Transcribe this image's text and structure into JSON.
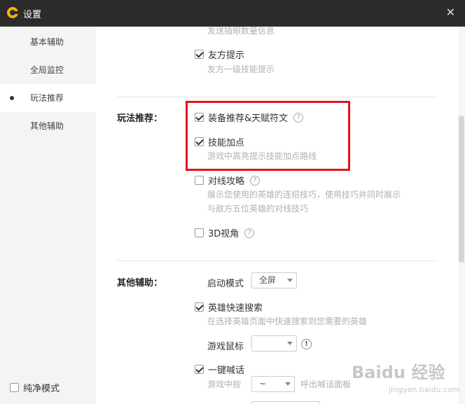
{
  "window": {
    "title": "设置",
    "close": "✕"
  },
  "sidebar": {
    "items": [
      {
        "label": "基本辅助"
      },
      {
        "label": "全局监控"
      },
      {
        "label": "玩法推荐"
      },
      {
        "label": "其他辅助"
      }
    ],
    "active_index": 2,
    "pure_mode": {
      "label": "纯净模式",
      "checked": false
    }
  },
  "content": {
    "top_partial_desc": "发送插眼数量信息",
    "friend_hint": {
      "label": "友方提示",
      "desc": "友方一级技能提示",
      "checked": true
    },
    "play_section": {
      "label": "玩法推荐：",
      "equip": {
        "label": "装备推荐&天赋符文",
        "checked": true
      },
      "skill": {
        "label": "技能加点",
        "desc": "游戏中高亮提示技能加点路线",
        "checked": true
      },
      "lane": {
        "label": "对线攻略",
        "desc1": "展示您使用的英雄的连招技巧，使用技巧并同时展示",
        "desc2": "与敌方五位英雄的对线技巧",
        "checked": false
      },
      "view3d": {
        "label": "3D视角",
        "checked": false
      }
    },
    "other_section": {
      "label": "其他辅助：",
      "start_mode": {
        "label": "启动模式",
        "value": "全屏"
      },
      "quick_search": {
        "label": "英雄快速搜索",
        "desc": "在选择英雄页面中快速搜索到您需要的英雄",
        "checked": true
      },
      "mouse": {
        "label": "游戏鼠标",
        "value": "",
        "warn": "!"
      },
      "shout": {
        "label": "一键喊话",
        "checked": true,
        "prefix": "游戏中按",
        "key": "~",
        "suffix": "呼出喊话面板"
      }
    },
    "help_glyph": "?"
  },
  "watermark": {
    "main": "Baidu 经验",
    "sub": "jingyan.baidu.com"
  },
  "colors": {
    "titlebar": "#2b2b2b",
    "logo": "#f5b400",
    "highlight": "#e0141e",
    "sidebar": "#f4f4f4"
  },
  "icons": [
    "logo-icon",
    "close-icon",
    "checkbox-icon",
    "help-icon",
    "dropdown-caret-icon",
    "warning-icon"
  ]
}
